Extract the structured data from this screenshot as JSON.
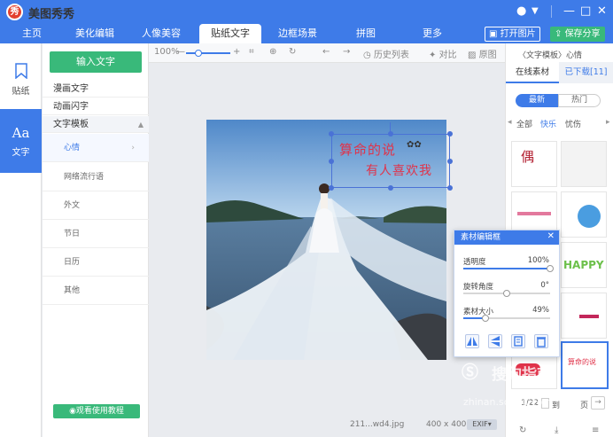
{
  "app": {
    "title": "美图秀秀",
    "logo_char": "秀"
  },
  "tabs": [
    {
      "label": "主页"
    },
    {
      "label": "美化编辑"
    },
    {
      "label": "人像美容"
    },
    {
      "label": "贴纸文字"
    },
    {
      "label": "边框场景"
    },
    {
      "label": "拼图"
    },
    {
      "label": "更多"
    }
  ],
  "header_buttons": {
    "open": "打开图片",
    "save": "保存分享"
  },
  "rail": [
    {
      "label": "贴纸",
      "icon": "sticker-icon"
    },
    {
      "label": "文字",
      "icon": "text-icon",
      "glyph": "Aa"
    }
  ],
  "category_panel": {
    "add_text": "输入文字",
    "categories": [
      "漫画文字",
      "动画闪字",
      "文字模板"
    ],
    "subcategories": [
      "心情",
      "网络流行语",
      "外文",
      "节日",
      "日历",
      "其他"
    ],
    "tutorial": "观看使用教程"
  },
  "toolbar": {
    "zoom": "100%",
    "history": "历史列表",
    "compare": "对比",
    "original": "原图"
  },
  "canvas": {
    "sticker_line1": "算命的说",
    "sticker_line2": "有人喜欢我"
  },
  "status": {
    "filename": "211...wd4.jpg",
    "dimensions": "400 x 400",
    "exif": "EXIF"
  },
  "right_panel": {
    "breadcrumb": "〈文字模板〉心情",
    "tab_online": "在线素材",
    "tab_downloaded": "已下载[11]",
    "sort_new": "最新",
    "sort_hot": "热门",
    "filters": [
      "全部",
      "快乐",
      "忧伤"
    ],
    "page_text": "1/22",
    "goto": "到",
    "page_suffix": "页"
  },
  "popup": {
    "title": "素材编辑框",
    "opacity_label": "透明度",
    "opacity_value": "100%",
    "rotate_label": "旋转角度",
    "rotate_value": "0°",
    "size_label": "素材大小",
    "size_value": "49%",
    "opacity_level": 1.0,
    "rotate_level": 0.5,
    "size_level": 0.25
  },
  "watermark": {
    "text": "搜狗指南",
    "url": "zhinan.sogou.com"
  },
  "colors": {
    "primary": "#3e7be8",
    "green": "#39b97a",
    "sticker_red": "#e0334a"
  }
}
